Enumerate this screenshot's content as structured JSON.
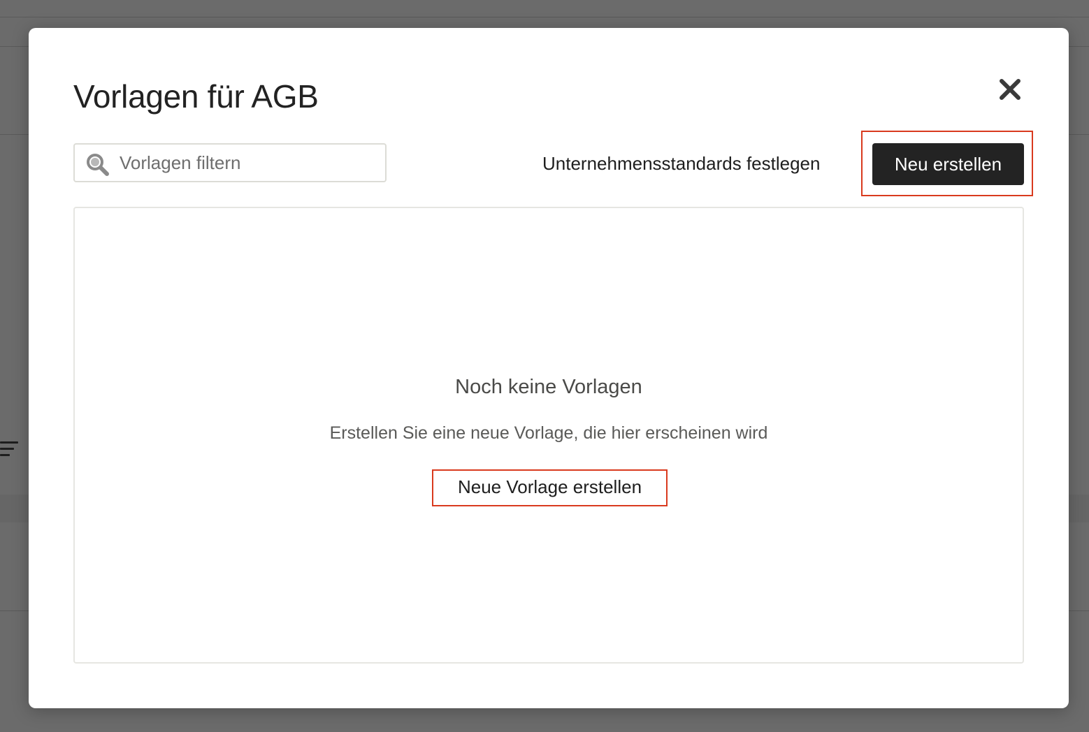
{
  "modal": {
    "title": "Vorlagen für AGB",
    "close_label": "Schließen"
  },
  "toolbar": {
    "search_placeholder": "Vorlagen filtern",
    "search_value": "",
    "standards_link": "Unternehmensstandards festlegen",
    "new_button": "Neu erstellen"
  },
  "empty_state": {
    "title": "Noch keine Vorlagen",
    "description": "Erstellen Sie eine neue Vorlage, die hier erscheinen wird",
    "create_link": "Neue Vorlage erstellen"
  },
  "icons": {
    "close": "close-icon",
    "search": "search-icon",
    "background_menu": "menu-icon"
  },
  "colors": {
    "overlay": "#6b6b6b",
    "primary_button": "#232323",
    "highlight": "#d93a1e",
    "title_text": "#222222"
  }
}
